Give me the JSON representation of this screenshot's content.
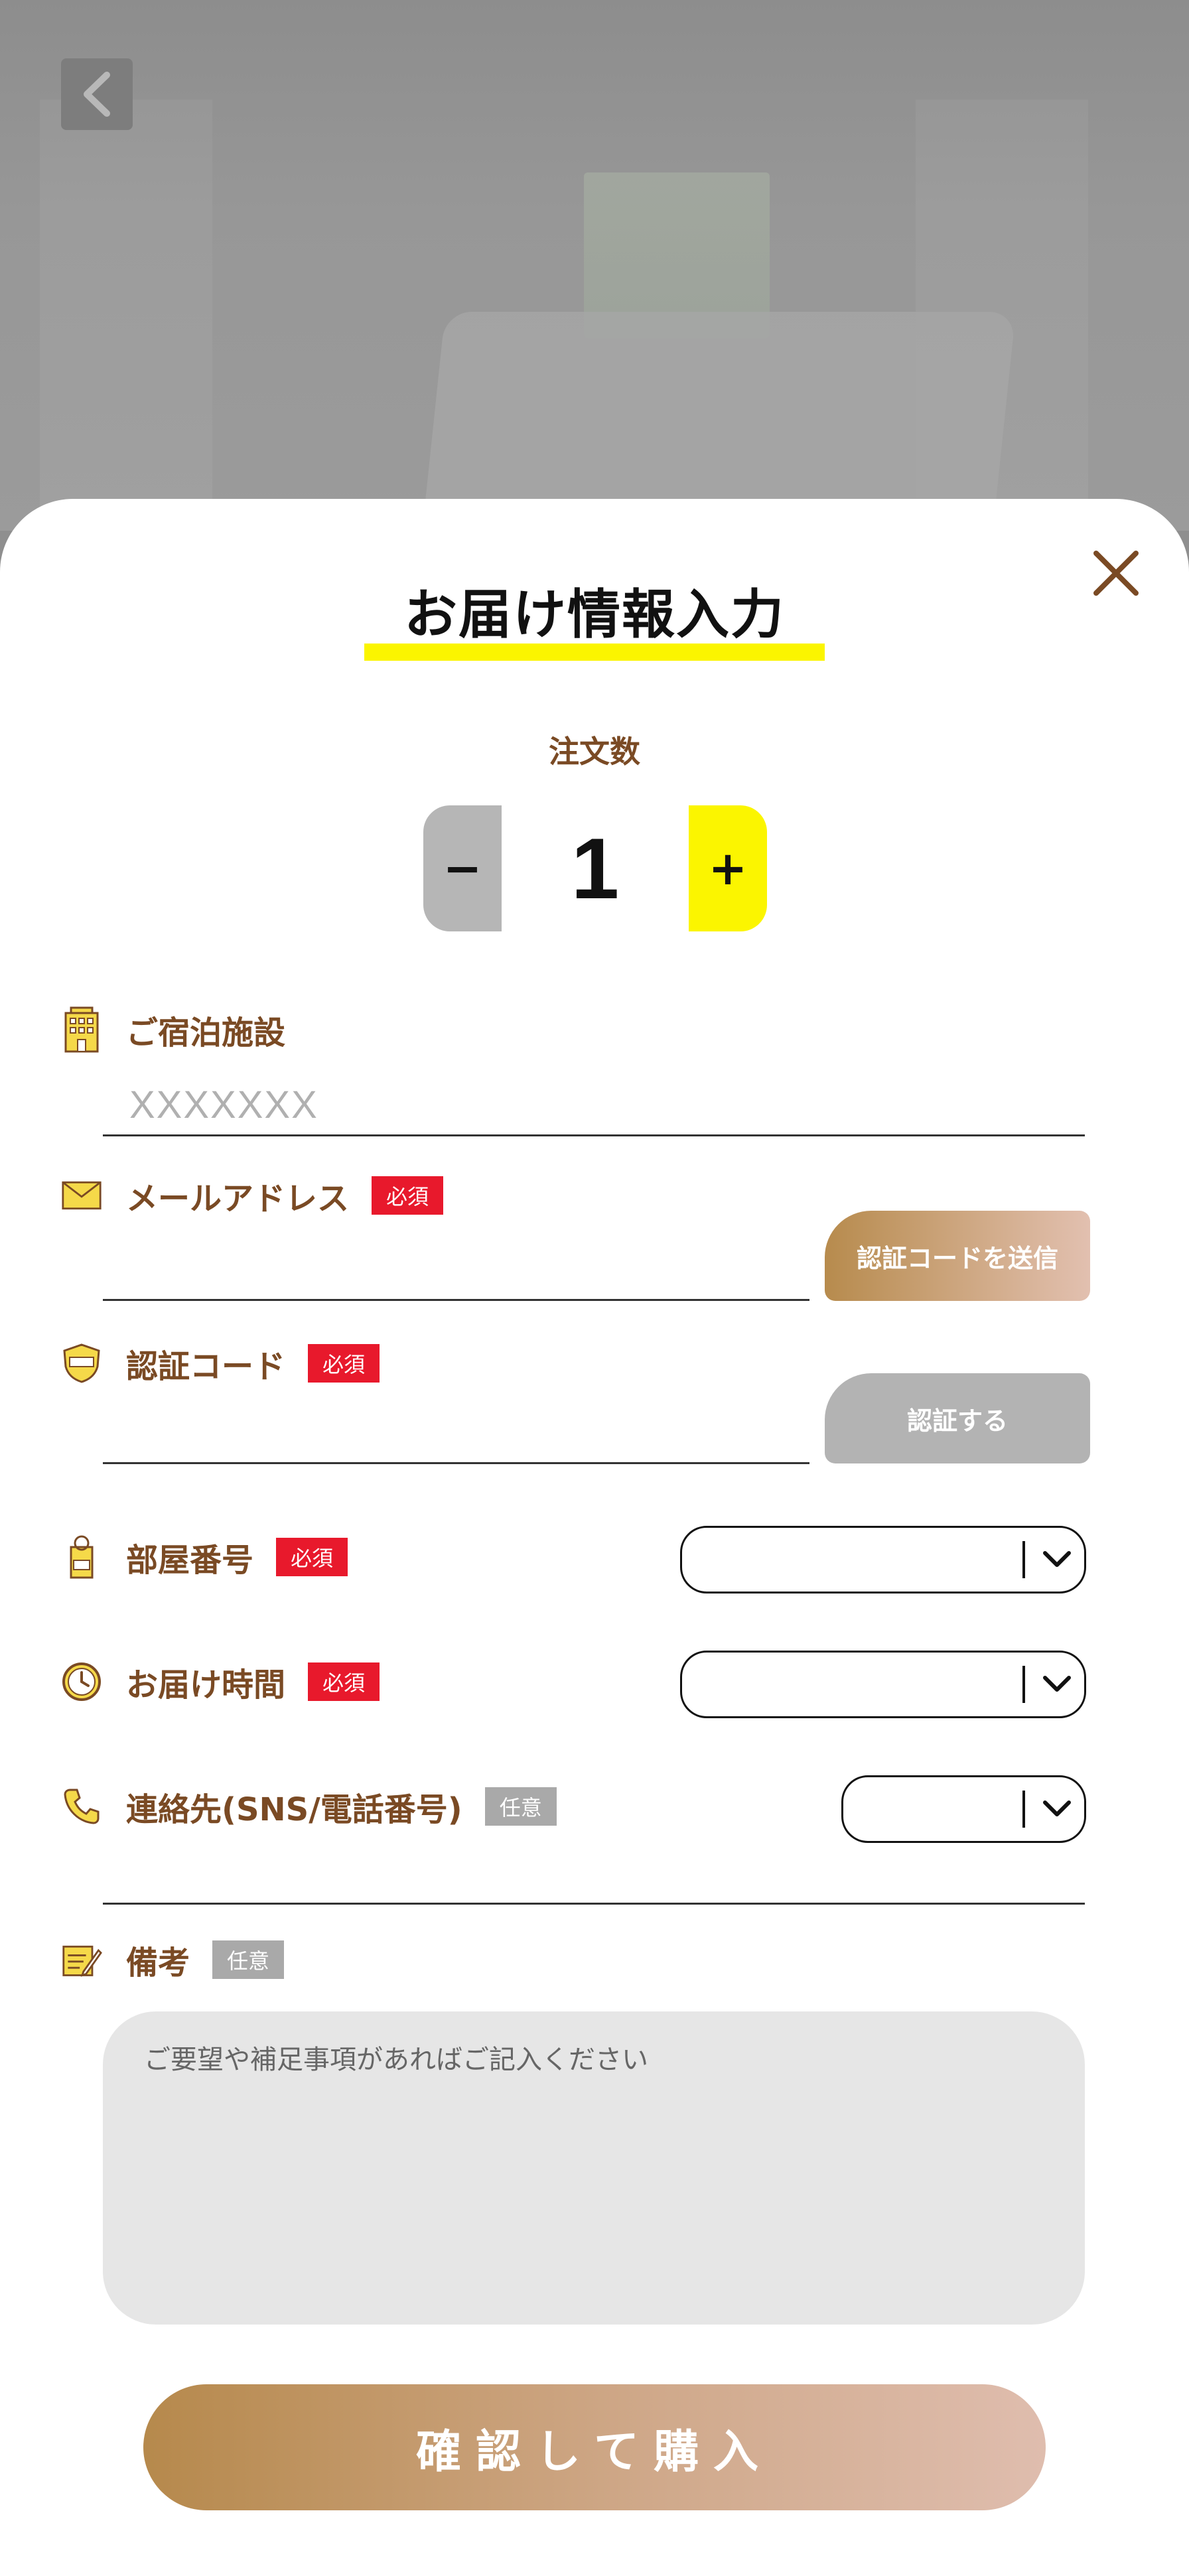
{
  "title": "お届け情報入力",
  "quantity": {
    "label": "注文数",
    "value": "1",
    "minus": "−",
    "plus": "+"
  },
  "facility": {
    "label": "ご宿泊施設",
    "value": "XXXXXXX"
  },
  "email": {
    "label": "メールアドレス",
    "badge": "必須",
    "button": "認証コードを送信"
  },
  "code": {
    "label": "認証コード",
    "badge": "必須",
    "button": "認証する"
  },
  "room": {
    "label": "部屋番号",
    "badge": "必須"
  },
  "delivery_time": {
    "label": "お届け時間",
    "badge": "必須"
  },
  "contact": {
    "label": "連絡先(SNS/電話番号)",
    "badge": "任意"
  },
  "notes": {
    "label": "備考",
    "badge": "任意",
    "placeholder": "ご要望や補足事項があればご記入ください"
  },
  "submit": "確認して購入",
  "colors": {
    "accent_yellow": "#fbf500",
    "brown": "#7a4a24",
    "required_red": "#e8192c",
    "gold_start": "#b6894c",
    "gold_end": "#dfbdae"
  }
}
